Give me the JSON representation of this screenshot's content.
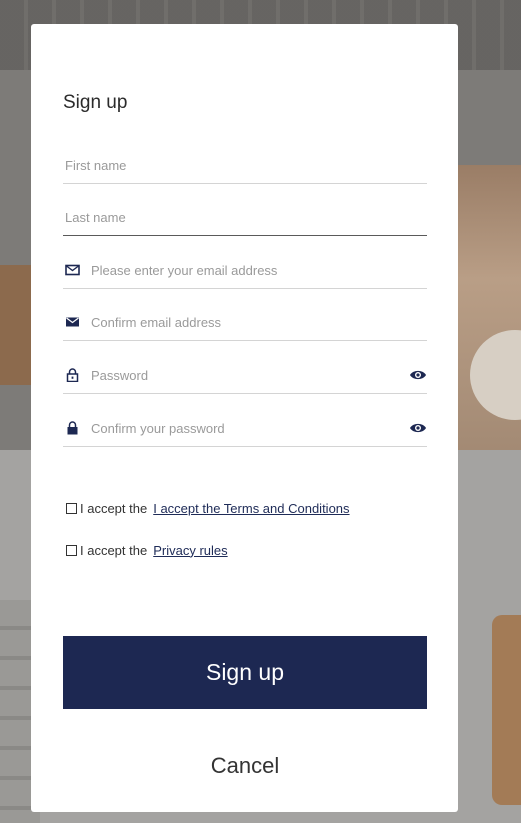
{
  "form": {
    "title": "Sign up",
    "fields": {
      "first_name": {
        "placeholder": "First name",
        "value": ""
      },
      "last_name": {
        "placeholder": "Last name",
        "value": ""
      },
      "email": {
        "placeholder": "Please enter your email address",
        "value": "",
        "icon": "envelope-outline-icon"
      },
      "confirm_email": {
        "placeholder": "Confirm email address",
        "value": "",
        "icon": "envelope-filled-icon"
      },
      "password": {
        "placeholder": "Password",
        "value": "",
        "icon": "lock-outline-icon",
        "toggle_icon": "eye-icon"
      },
      "confirm_password": {
        "placeholder": "Confirm your password",
        "value": "",
        "icon": "lock-filled-icon",
        "toggle_icon": "eye-icon"
      }
    },
    "consents": [
      {
        "prefix": "I accept the",
        "link_text": "I accept the Terms and Conditions",
        "checked": false
      },
      {
        "prefix": "I accept the",
        "link_text": "Privacy rules",
        "checked": false
      }
    ],
    "submit_label": "Sign up",
    "cancel_label": "Cancel"
  },
  "colors": {
    "primary": "#1d2852",
    "link": "#1e2b57",
    "modal_background": "#ffffff",
    "placeholder": "#9a9a9a"
  }
}
